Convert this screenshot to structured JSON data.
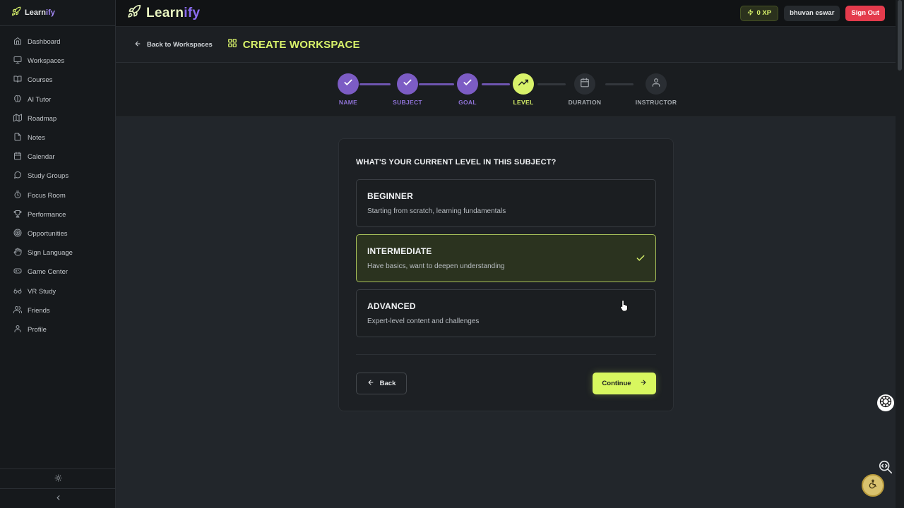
{
  "sidebar": {
    "logo": {
      "text_main": "Learn",
      "text_accent": "ify"
    },
    "items": [
      {
        "label": "Dashboard",
        "icon": "home-icon"
      },
      {
        "label": "Workspaces",
        "icon": "monitor-icon"
      },
      {
        "label": "Courses",
        "icon": "book-icon"
      },
      {
        "label": "AI Tutor",
        "icon": "brain-icon"
      },
      {
        "label": "Roadmap",
        "icon": "map-icon"
      },
      {
        "label": "Notes",
        "icon": "file-icon"
      },
      {
        "label": "Calendar",
        "icon": "calendar-icon"
      },
      {
        "label": "Study Groups",
        "icon": "chat-icon"
      },
      {
        "label": "Focus Room",
        "icon": "timer-icon"
      },
      {
        "label": "Performance",
        "icon": "trophy-icon"
      },
      {
        "label": "Opportunities",
        "icon": "target-icon"
      },
      {
        "label": "Sign Language",
        "icon": "hand-icon"
      },
      {
        "label": "Game Center",
        "icon": "gamepad-icon"
      },
      {
        "label": "VR Study",
        "icon": "vr-icon"
      },
      {
        "label": "Friends",
        "icon": "users-icon"
      },
      {
        "label": "Profile",
        "icon": "user-icon"
      }
    ]
  },
  "topbar": {
    "logo": {
      "text_main": "Learn",
      "text_accent": "ify"
    },
    "xp": "0 XP",
    "user": "bhuvan eswar",
    "signout": "Sign Out"
  },
  "header": {
    "back_label": "Back to Workspaces",
    "title": "CREATE WORKSPACE"
  },
  "stepper": {
    "steps": [
      {
        "label": "NAME",
        "state": "done",
        "icon": "check-icon"
      },
      {
        "label": "SUBJECT",
        "state": "done",
        "icon": "check-icon"
      },
      {
        "label": "GOAL",
        "state": "done",
        "icon": "check-icon"
      },
      {
        "label": "LEVEL",
        "state": "current",
        "icon": "trending-up-icon"
      },
      {
        "label": "DURATION",
        "state": "pending",
        "icon": "calendar-icon"
      },
      {
        "label": "INSTRUCTOR",
        "state": "pending",
        "icon": "user-icon"
      }
    ]
  },
  "card": {
    "question": "WHAT'S YOUR CURRENT LEVEL IN THIS SUBJECT?",
    "options": [
      {
        "title": "BEGINNER",
        "desc": "Starting from scratch, learning fundamentals",
        "selected": false
      },
      {
        "title": "INTERMEDIATE",
        "desc": "Have basics, want to deepen understanding",
        "selected": true
      },
      {
        "title": "ADVANCED",
        "desc": "Expert-level content and challenges",
        "selected": false
      }
    ],
    "back_label": "Back",
    "continue_label": "Continue"
  },
  "colors": {
    "accent_lime": "#d8f26a",
    "accent_purple": "#7c5cc4",
    "danger": "#e43b4c"
  }
}
